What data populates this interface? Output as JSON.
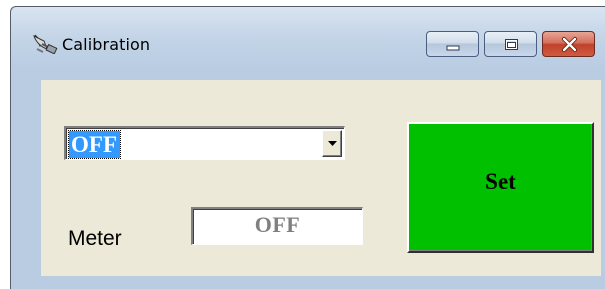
{
  "window": {
    "title": "Calibration",
    "icon": "satellite-dish-icon",
    "controls": {
      "minimize_icon": "minimize-icon",
      "maximize_icon": "maximize-icon",
      "close_icon": "close-icon"
    }
  },
  "form": {
    "mode_select": {
      "selected": "OFF",
      "dropdown_icon": "chevron-down-icon"
    },
    "meter": {
      "label": "Meter",
      "value": "OFF"
    },
    "set_button": {
      "label": "Set",
      "color": "#00c000"
    }
  },
  "colors": {
    "client_background": "#ece9d8",
    "selection": "#3399ff",
    "close_button": "#c0412a"
  }
}
